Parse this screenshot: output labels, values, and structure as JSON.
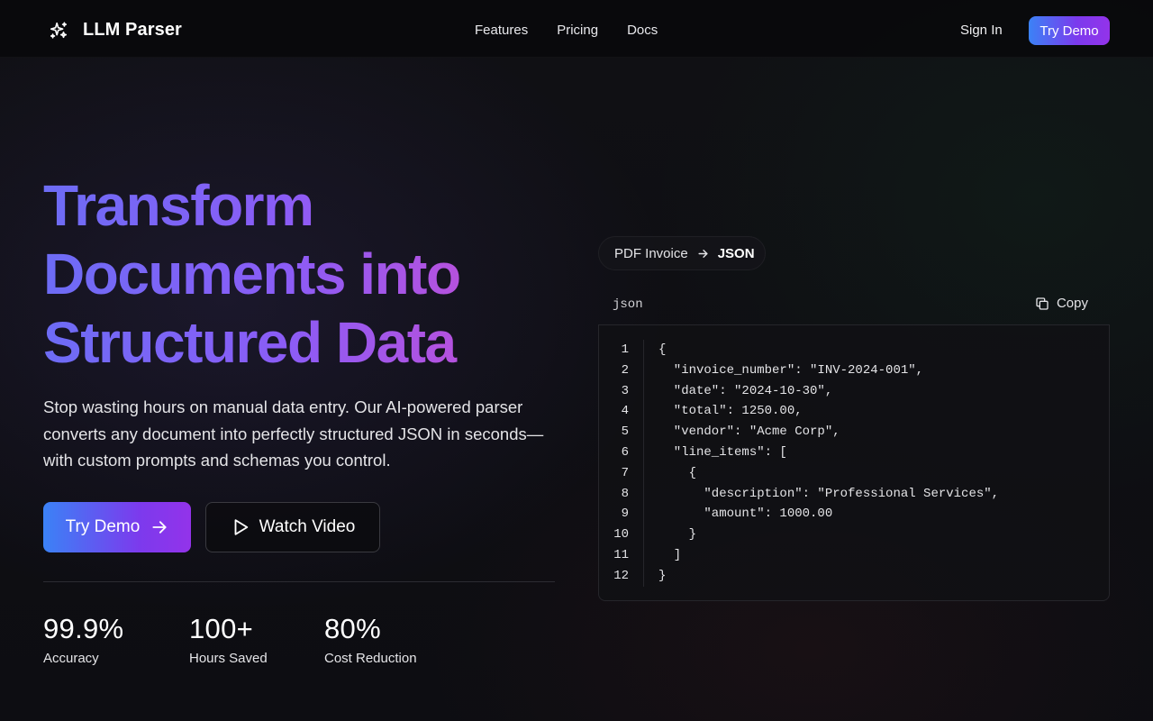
{
  "nav": {
    "brand": "LLM Parser",
    "links": [
      "Features",
      "Pricing",
      "Docs"
    ],
    "sign_in": "Sign In",
    "try_demo": "Try Demo"
  },
  "hero": {
    "title_lines": [
      "Transform",
      "Documents into",
      "Structured Data"
    ],
    "subtitle": "Stop wasting hours on manual data entry. Our AI-powered parser converts any document into perfectly structured JSON in seconds—with custom prompts and schemas you control.",
    "primary_button": "Try Demo",
    "secondary_button": "Watch Video"
  },
  "stats": [
    {
      "value": "99.9%",
      "label": "Accuracy"
    },
    {
      "value": "100+",
      "label": "Hours Saved"
    },
    {
      "value": "80%",
      "label": "Cost Reduction"
    }
  ],
  "conversion": {
    "from": "PDF Invoice",
    "to": "JSON"
  },
  "code": {
    "language": "json",
    "copy_label": "Copy",
    "line_numbers": [
      "1",
      "2",
      "3",
      "4",
      "5",
      "6",
      "7",
      "8",
      "9",
      "10",
      "11",
      "12"
    ],
    "lines": [
      "{",
      "  \"invoice_number\": \"INV-2024-001\",",
      "  \"date\": \"2024-10-30\",",
      "  \"total\": 1250.00,",
      "  \"vendor\": \"Acme Corp\",",
      "  \"line_items\": [",
      "    {",
      "      \"description\": \"Professional Services\",",
      "      \"amount\": 1000.00",
      "    }",
      "  ]",
      "}"
    ]
  },
  "colors": {
    "accent_start": "#3b82f6",
    "accent_end": "#9333ea",
    "background": "#0b0b0e"
  }
}
